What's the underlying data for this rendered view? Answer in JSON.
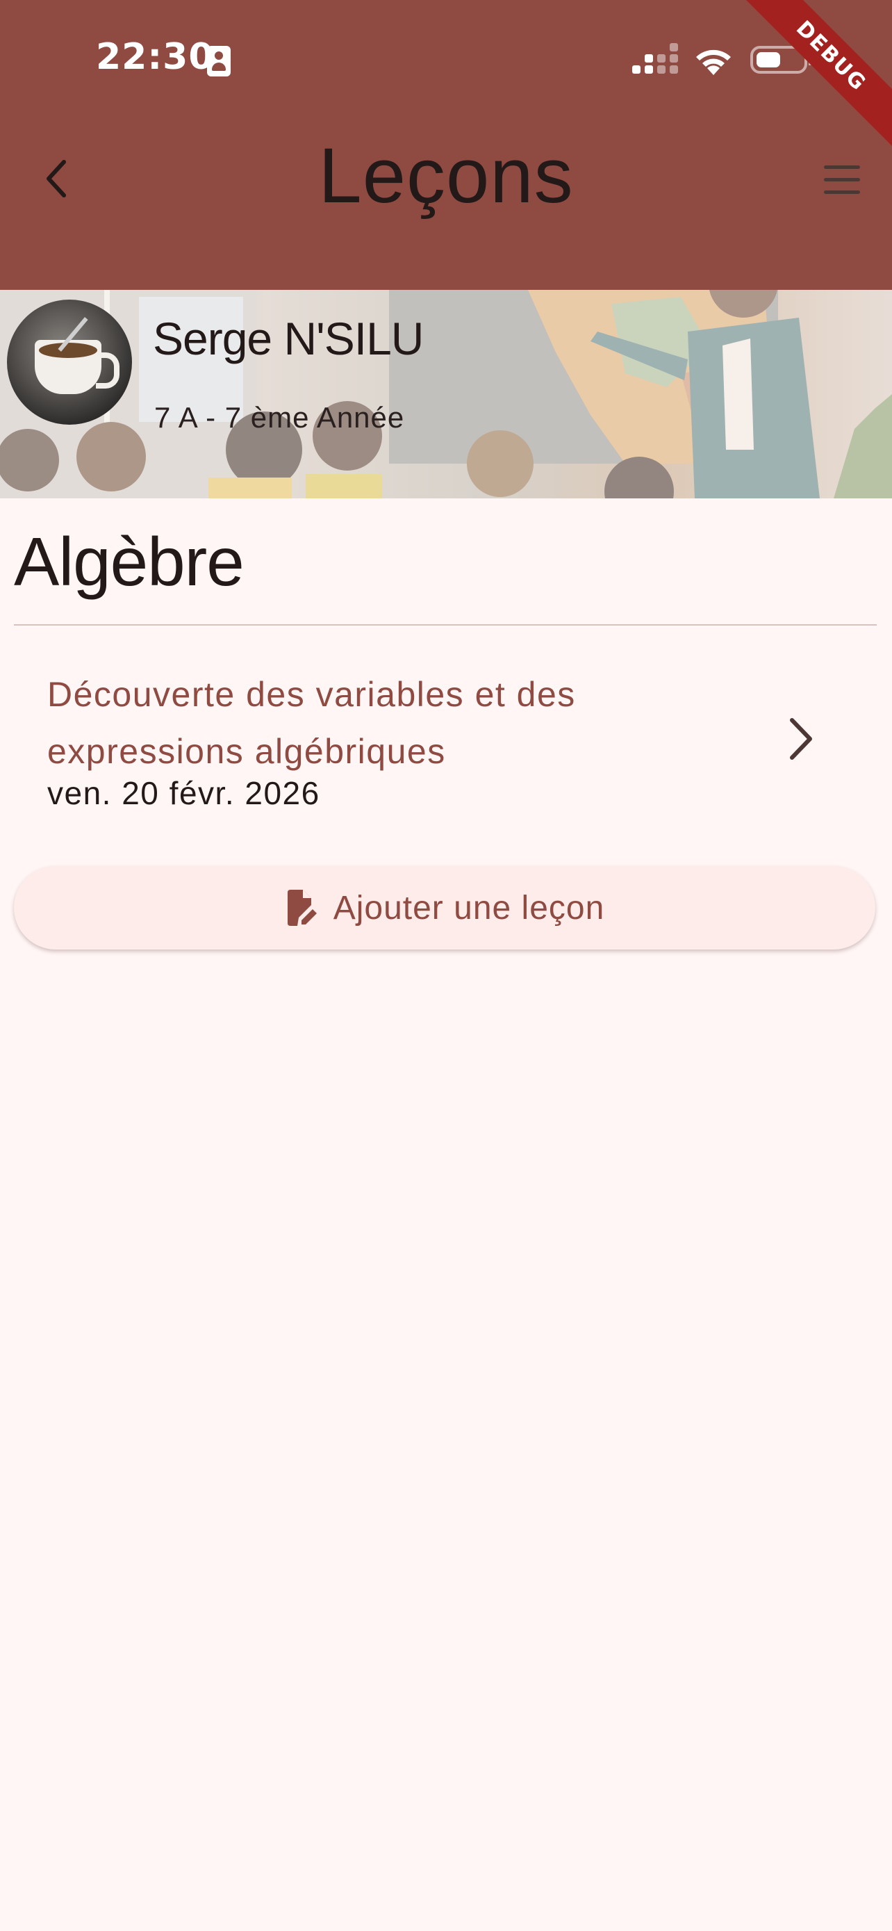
{
  "status_bar": {
    "time": "22:30",
    "debug_banner": "DEBUG"
  },
  "appbar": {
    "title": "Leçons",
    "back_icon": "chevron-left-icon",
    "menu_icon": "hamburger-menu-icon"
  },
  "header": {
    "teacher_name": "Serge N'SILU",
    "class_label": "7 A - 7 ème Année",
    "avatar_icon": "avatar-coffee-cup"
  },
  "subject": {
    "title": "Algèbre"
  },
  "lessons": [
    {
      "title": "Découverte des variables et des expressions algébriques",
      "date": "ven. 20 févr. 2026"
    }
  ],
  "add_button": {
    "label": "Ajouter une leçon",
    "icon": "edit-document-icon"
  },
  "colors": {
    "primary": "#8f4a42",
    "background": "#fff6f5",
    "button_bg": "#feecea",
    "text": "#221918"
  }
}
